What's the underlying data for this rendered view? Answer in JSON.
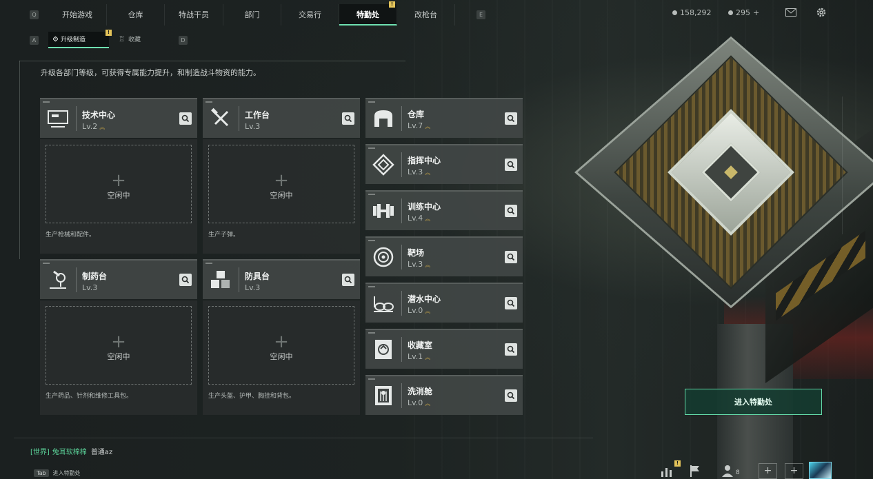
{
  "topbar": {
    "left_key": "Q",
    "right_key": "E",
    "tabs": [
      {
        "label": "开始游戏",
        "active": false
      },
      {
        "label": "仓库",
        "active": false
      },
      {
        "label": "特战干员",
        "active": false
      },
      {
        "label": "部门",
        "active": false
      },
      {
        "label": "交易行",
        "active": false
      },
      {
        "label": "特勤处",
        "active": true,
        "badge": "!"
      },
      {
        "label": "改枪台",
        "active": false
      }
    ],
    "currency_1": "158,292",
    "currency_2": "295",
    "currency_2_add": "+",
    "mail_icon": "mail-icon",
    "settings_icon": "gear-icon"
  },
  "subtabs": {
    "left_key": "A",
    "right_key": "D",
    "items": [
      {
        "label": "升级制造",
        "active": true,
        "badge": "!"
      },
      {
        "label": "收藏",
        "active": false
      }
    ]
  },
  "description": "升级各部门等级，可获得专属能力提升，和制造战斗物资的能力。",
  "departments_left": [
    {
      "name": "技术中心",
      "level": "Lv.2",
      "icon": "computer-icon",
      "slot_label": "空闲中",
      "desc": "生产枪械和配件。"
    },
    {
      "name": "工作台",
      "level": "Lv.3",
      "icon": "tools-icon",
      "slot_label": "空闲中",
      "desc": "生产子弹。"
    },
    {
      "name": "制药台",
      "level": "Lv.3",
      "icon": "microscope-icon",
      "slot_label": "空闲中",
      "desc": "生产药品、针剂和维修工具包。"
    },
    {
      "name": "防具台",
      "level": "Lv.3",
      "icon": "armor-boxes-icon",
      "slot_label": "空闲中",
      "desc": "生产头盔、护甲、胸挂和背包。"
    }
  ],
  "departments_right": [
    {
      "name": "仓库",
      "level": "Lv.7",
      "icon": "warehouse-icon"
    },
    {
      "name": "指挥中心",
      "level": "Lv.3",
      "icon": "command-diamond-icon"
    },
    {
      "name": "训练中心",
      "level": "Lv.4",
      "icon": "dumbbell-icon"
    },
    {
      "name": "靶场",
      "level": "Lv.3",
      "icon": "target-icon"
    },
    {
      "name": "潜水中心",
      "level": "Lv.0",
      "icon": "diving-goggles-icon"
    },
    {
      "name": "收藏室",
      "level": "Lv.1",
      "icon": "collection-icon"
    },
    {
      "name": "洗消舱",
      "level": "Lv.0",
      "icon": "decontamination-icon"
    }
  ],
  "enter_button": "进入特勤处",
  "chat": {
    "channel": "[世界]",
    "user": "兔耳软棉棉",
    "message": "普通az"
  },
  "tab_hint": {
    "key": "Tab",
    "label": "进入特勤处"
  },
  "bottom": {
    "friends_count": "8",
    "add_1": "+",
    "add_2": "+"
  },
  "colors": {
    "accent": "#6ee0b0",
    "badge": "#e4c45a",
    "card_bg": "#41464588"
  }
}
